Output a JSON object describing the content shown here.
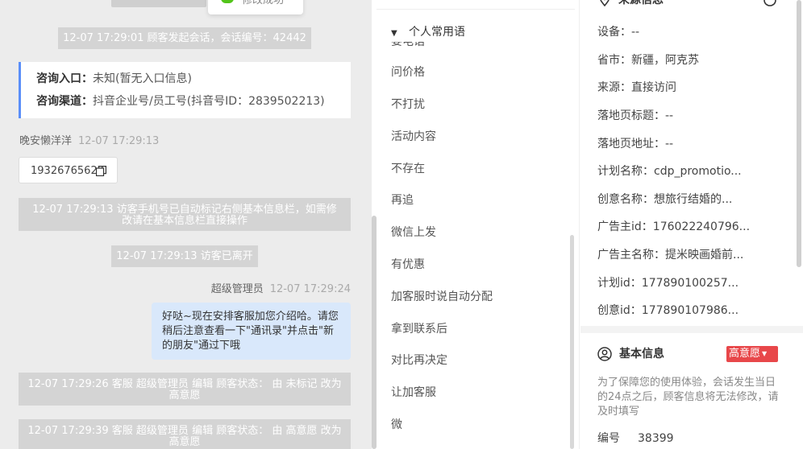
{
  "toast": {
    "text": "修改成功"
  },
  "chat": {
    "system_session": "12-07 17:29:01 顾客发起会话，会话编号：42442",
    "entry": {
      "label": "咨询入口：",
      "value": "未知(暂无入口信息)"
    },
    "channel": {
      "label": "咨询渠道：",
      "value": "抖音企业号/员工号(抖音号ID：2839502213)"
    },
    "visitor_name": "晚安懒洋洋",
    "visitor_time": "12-07 17:29:13",
    "visitor_phone": "19326765627",
    "system_phone_note": "12-07 17:29:13 访客手机号已自动标记右侧基本信息栏，如需修改请在基本信息栏直接操作",
    "system_left": "12-07 17:29:13 访客已离开",
    "agent_name": "超级管理员",
    "agent_time": "12-07 17:29:24",
    "agent_message": "好哒~现在安排客服加您介绍哈。请您稍后注意查看一下\"通讯录\"并点击\"新的朋友\"通过下哦",
    "system_status_1": "12-07 17:29:26 客服 超级管理员 编辑 顾客状态： 由 未标记 改为 高意愿",
    "system_status_2": "12-07 17:29:39 客服 超级管理员 编辑 顾客状态： 由 高意愿 改为 高意愿"
  },
  "phrases": {
    "ghost_item": "要电话",
    "group_title": "个人常用语",
    "items": [
      "问价格",
      "不打扰",
      "活动内容",
      "不存在",
      "再追",
      "微信上发",
      "有优惠",
      "加客服时说自动分配",
      "拿到联系后",
      "对比再决定",
      "让加客服",
      "微"
    ]
  },
  "customer": {
    "source_title": "来源信息",
    "fields": [
      {
        "label": "设备：",
        "value": "--"
      },
      {
        "label": "省市：",
        "value": "新疆，阿克苏"
      },
      {
        "label": "来源：",
        "value": "直接访问"
      },
      {
        "label": "落地页标题：",
        "value": "--"
      },
      {
        "label": "落地页地址：",
        "value": "--"
      },
      {
        "label": "计划名称：",
        "value": "cdp_promotio..."
      },
      {
        "label": "创意名称：",
        "value": "想旅行结婚的..."
      },
      {
        "label": "广告主id：",
        "value": "176022240796..."
      },
      {
        "label": "广告主名称：",
        "value": "提米映画婚前..."
      },
      {
        "label": "计划id：",
        "value": "177890100257..."
      },
      {
        "label": "创意id：",
        "value": "177890107986..."
      }
    ],
    "basic_title": "基本信息",
    "intent_badge": "高意愿",
    "notice": "为了保障您的使用体验，会话发生当日的24点之后，顾客信息将无法修改，请及时填写",
    "id_label": "编号",
    "id_value": "38399",
    "icons": {
      "source": "location-pin-icon",
      "edit": "edit-icon",
      "basic": "user-circle-icon",
      "copy": "copy-icon"
    },
    "colors": {
      "badge": "#e8474a",
      "agent_bubble": "#d9e8fb",
      "accent": "#5b8ff9"
    }
  }
}
